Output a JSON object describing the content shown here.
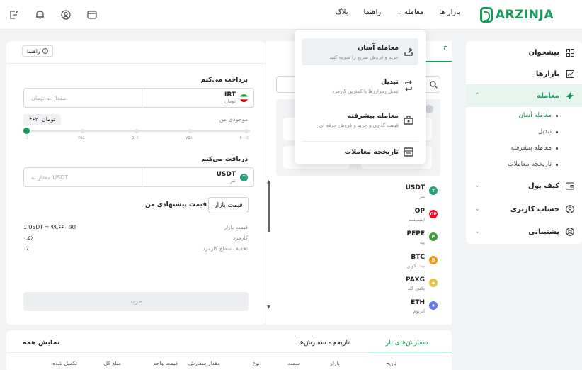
{
  "brand": {
    "name": "ARZINJA",
    "color": "#1a9b5b"
  },
  "header": {
    "nav": [
      {
        "label": "بازار ها",
        "dropdown": false
      },
      {
        "label": "معامله",
        "dropdown": true
      },
      {
        "label": "راهنما",
        "dropdown": false
      },
      {
        "label": "بلاگ",
        "dropdown": false
      }
    ],
    "icons": [
      "wallet-icon",
      "user-icon",
      "bell-icon",
      "logout-icon"
    ]
  },
  "sidebar": {
    "items": [
      {
        "label": "پیشخوان",
        "icon": "dashboard-icon"
      },
      {
        "label": "بازارها",
        "icon": "markets-icon"
      },
      {
        "label": "معامله",
        "icon": "trade-icon",
        "active": true
      },
      {
        "label": "کیف پول",
        "icon": "wallet-icon"
      },
      {
        "label": "حساب کاربری",
        "icon": "user-icon"
      },
      {
        "label": "پشتیبانی",
        "icon": "support-icon"
      }
    ],
    "sub_items": [
      {
        "label": "معامله آسان",
        "active": true
      },
      {
        "label": "تبدیل"
      },
      {
        "label": "معامله پیشرفته"
      },
      {
        "label": "تاریخچه معاملات"
      }
    ]
  },
  "dropdown": {
    "items": [
      {
        "title": "معامله آسان",
        "desc": "خرید و فروش سریع را تجربه کنید",
        "icon": "easy-trade-icon"
      },
      {
        "title": "تبدیل",
        "desc": "تبدیل رمزارزها با کمترین کارمزد",
        "icon": "convert-icon"
      },
      {
        "title": "معامله پیشرفته",
        "desc": "قیمت گذاری و خرید و فروش حرفه ای",
        "icon": "advanced-trade-icon"
      },
      {
        "title": "تاریخچه معاملات",
        "desc": "",
        "icon": "history-icon"
      }
    ]
  },
  "trade": {
    "help": "راهنما",
    "pay_label": "پرداخت می‌کنم",
    "pay_currency": {
      "code": "IRT",
      "name": "تومان"
    },
    "pay_placeholder": "مقدار به تومان",
    "balance_label": "موجودی من",
    "balance_value": "۴۶۲",
    "balance_unit": "تومان",
    "slider_ticks": [
      "۰٪",
      "۲۵٪",
      "۵۰٪",
      "۷۵٪",
      "۱۰۰٪"
    ],
    "slider_level": 0,
    "receive_label": "دریافت می‌کنم",
    "receive_currency": {
      "code": "USDT",
      "name": "تتر"
    },
    "receive_placeholder": "مقدار به USDT",
    "market_price_btn": "قیمت بازار",
    "proposed_price": "قیمت پیشنهادی من",
    "info": [
      {
        "label": "قیمت بازار",
        "value": "1 USDT = ۹۹،۶۶۰ IRT"
      },
      {
        "label": "کارمزد",
        "value": "۰.۵٪"
      },
      {
        "label": "تخفیف سطح کارمزد",
        "value": "۰٪"
      }
    ],
    "buy_btn": "خرید"
  },
  "market": {
    "tab_fragment": "خ",
    "coins": [
      {
        "symbol": "USDT",
        "name": "تتر",
        "color": "#26a17b",
        "icon": "usdt-icon"
      },
      {
        "symbol": "OP",
        "name": "اپتیمیسم",
        "color": "#ff0420",
        "icon": "op-icon"
      },
      {
        "symbol": "PEPE",
        "name": "پپه",
        "color": "#3d9b3d",
        "icon": "pepe-icon"
      },
      {
        "symbol": "BTC",
        "name": "بیت کوین",
        "color": "#f7931a",
        "icon": "btc-icon"
      },
      {
        "symbol": "PAXG",
        "name": "پکس گلد",
        "color": "#e4c340",
        "icon": "paxg-icon"
      },
      {
        "symbol": "ETH",
        "name": "اتریوم",
        "color": "#627eea",
        "icon": "eth-icon"
      }
    ]
  },
  "orders": {
    "tabs": [
      "سفارش‌های باز",
      "تاریخچه سفارش‌ها"
    ],
    "show_all": "نمایش همه",
    "columns": [
      "تاریخ",
      "بازار",
      "سمت",
      "نوع",
      "مقدار سفارش",
      "قیمت واحد",
      "مبلغ کل",
      "تکمیل شده"
    ]
  }
}
